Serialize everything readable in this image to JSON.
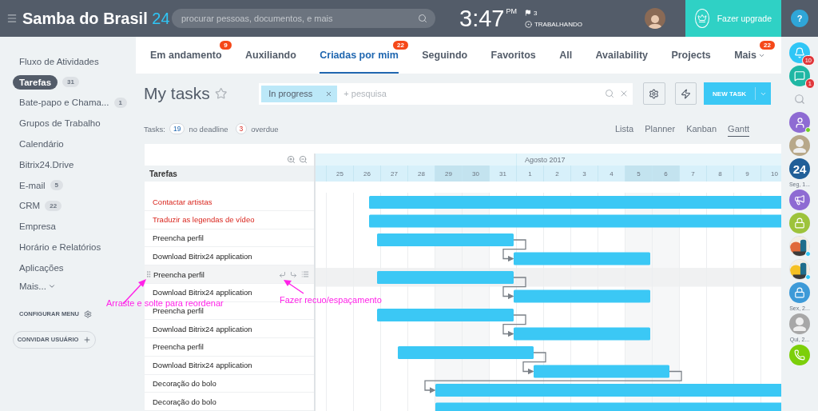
{
  "header": {
    "title": "Samba do Brasil",
    "title_suffix": "24",
    "search": {
      "placeholder": "procurar pessoas, documentos, e mais"
    },
    "time": "3:47",
    "meridiem": "PM",
    "flag_count": "3",
    "status": "TRABALHANDO",
    "upgrade": "Fazer upgrade",
    "help": "?"
  },
  "sidebar": {
    "items": [
      {
        "label": "Fluxo de Atividades",
        "selected": false
      },
      {
        "label": "Tarefas",
        "count": "31",
        "selected": true
      },
      {
        "label": "Bate-papo e Chama...",
        "count": "1",
        "selected": false
      },
      {
        "label": "Grupos de Trabalho",
        "selected": false
      },
      {
        "label": "Calendário",
        "selected": false
      },
      {
        "label": "Bitrix24.Drive",
        "selected": false
      },
      {
        "label": "E-mail",
        "count": "5",
        "selected": false
      },
      {
        "label": "CRM",
        "count": "22",
        "selected": false
      },
      {
        "label": "Empresa",
        "selected": false
      },
      {
        "label": "Horário e Relatórios",
        "selected": false
      },
      {
        "label": "Aplicações",
        "selected": false
      }
    ],
    "more": "Mais...",
    "configure": "CONFIGURAR MENU",
    "invite": "CONVIDAR USUÁRIO"
  },
  "tabs": [
    {
      "label": "Em andamento",
      "badge": "9",
      "selected": false,
      "kind": "tab"
    },
    {
      "label": "Auxiliando",
      "selected": false,
      "kind": "tab"
    },
    {
      "label": "Criadas por mim",
      "badge": "22",
      "selected": true,
      "kind": "tab"
    },
    {
      "label": "Seguindo",
      "selected": false,
      "kind": "tab"
    },
    {
      "label": "Favoritos",
      "selected": false,
      "kind": "tab"
    },
    {
      "label": "All",
      "selected": false,
      "kind": "tab"
    },
    {
      "label": "Availability",
      "selected": false,
      "kind": "tab"
    },
    {
      "label": "Projects",
      "selected": false,
      "kind": "tab"
    },
    {
      "label": "Mais",
      "badge": "22",
      "selected": false,
      "kind": "menu"
    }
  ],
  "toolbar": {
    "title": "My tasks",
    "filter_chip": "In progress",
    "placeholder": "+ pesquisa",
    "new_task": "NEW TASK"
  },
  "counters": {
    "label": "Tasks:",
    "items": [
      {
        "count": "19",
        "text": "no deadline",
        "kind": "neutral"
      },
      {
        "count": "3",
        "text": "overdue",
        "kind": "alert"
      }
    ]
  },
  "views": [
    {
      "label": "Lista",
      "selected": false
    },
    {
      "label": "Planner",
      "selected": false
    },
    {
      "label": "Kanban",
      "selected": false
    },
    {
      "label": "Gantt",
      "selected": true
    }
  ],
  "gantt": {
    "column_title": "Tarefas",
    "month": "Agosto 2017",
    "days": [
      {
        "label": "25",
        "weekend": false
      },
      {
        "label": "26",
        "weekend": false
      },
      {
        "label": "27",
        "weekend": false
      },
      {
        "label": "28",
        "weekend": false
      },
      {
        "label": "29",
        "weekend": true
      },
      {
        "label": "30",
        "weekend": true
      },
      {
        "label": "31",
        "weekend": false
      },
      {
        "label": "1",
        "weekend": false
      },
      {
        "label": "2",
        "weekend": false
      },
      {
        "label": "3",
        "weekend": false
      },
      {
        "label": "4",
        "weekend": false
      },
      {
        "label": "5",
        "weekend": true
      },
      {
        "label": "6",
        "weekend": true
      },
      {
        "label": "7",
        "weekend": false
      },
      {
        "label": "8",
        "weekend": false
      },
      {
        "label": "9",
        "weekend": false
      },
      {
        "label": "10",
        "weekend": false
      }
    ],
    "tasks": [
      {
        "name": "Contactar artistas",
        "overdue": true,
        "hovered": false
      },
      {
        "name": "Traduzir as legendas de vídeo",
        "overdue": true,
        "hovered": false
      },
      {
        "name": "Preencha perfil",
        "overdue": false,
        "hovered": false
      },
      {
        "name": "Download Bitrix24 application",
        "overdue": false,
        "hovered": false
      },
      {
        "name": "Preencha perfil",
        "overdue": false,
        "hovered": true
      },
      {
        "name": "Download Bitrix24 application",
        "overdue": false,
        "hovered": false
      },
      {
        "name": "Preencha perfil",
        "overdue": false,
        "hovered": false
      },
      {
        "name": "Download Bitrix24 application",
        "overdue": false,
        "hovered": false
      },
      {
        "name": "Preencha perfil",
        "overdue": false,
        "hovered": false
      },
      {
        "name": "Download Bitrix24 application",
        "overdue": false,
        "hovered": false
      },
      {
        "name": "Decoração do bolo",
        "overdue": false,
        "hovered": false
      },
      {
        "name": "Decoração do bolo",
        "overdue": false,
        "hovered": false
      }
    ]
  },
  "annotations": [
    {
      "text": "Arraste e solte para reordenar"
    },
    {
      "text": "Fazer recuo/espaçamento"
    }
  ],
  "right_bar": {
    "items": [
      {
        "kind": "bell",
        "color": "#2fc6f6",
        "badge": "10"
      },
      {
        "kind": "chat",
        "color": "#1fb7a4",
        "badge": "1"
      },
      {
        "kind": "search"
      },
      {
        "kind": "user",
        "color": "#8e6bd3",
        "online": true
      },
      {
        "kind": "avatar",
        "color": "#b8a88a"
      },
      {
        "kind": "logo",
        "color": "#215f98",
        "text": "24"
      },
      {
        "kind": "label",
        "text": "Seg, 1..."
      },
      {
        "kind": "megaphone",
        "color": "#8e6bd3"
      },
      {
        "kind": "lock",
        "color": "#9dc33b"
      },
      {
        "kind": "picture",
        "color": "#e06a3b",
        "notified": true
      },
      {
        "kind": "picture",
        "color": "#f5c022",
        "notified": true
      },
      {
        "kind": "lock",
        "color": "#3d9ad8"
      },
      {
        "kind": "label",
        "text": "Sex, 2..."
      },
      {
        "kind": "avatar",
        "color": "#a7a7a7"
      },
      {
        "kind": "label",
        "text": "Qui, 2..."
      },
      {
        "kind": "phone",
        "color": "#7ccf0a"
      }
    ]
  }
}
